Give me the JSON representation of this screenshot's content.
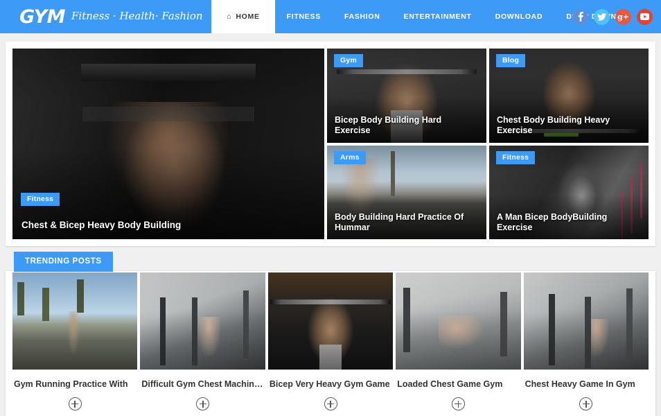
{
  "header": {
    "brand_logo": "GYM",
    "brand_tagline": "Fitness · Health· Fashion",
    "nav": [
      {
        "label": "HOME",
        "icon": "home-icon",
        "active": true
      },
      {
        "label": "FITNESS",
        "active": false
      },
      {
        "label": "FASHION",
        "active": false
      },
      {
        "label": "ENTERTAINMENT",
        "active": false
      },
      {
        "label": "DOWNLOAD",
        "active": false
      },
      {
        "label": "DROP DOWN",
        "active": false,
        "caret": true
      }
    ],
    "social": [
      {
        "name": "facebook-icon",
        "glyph": "f",
        "color": "#5b8fdb"
      },
      {
        "name": "twitter-icon",
        "glyph": "t",
        "color": "#4fc3f7"
      },
      {
        "name": "googleplus-icon",
        "glyph": "g+",
        "color": "#e8573f"
      },
      {
        "name": "youtube-icon",
        "glyph": "yt",
        "color": "#e8402f"
      }
    ],
    "accent_color": "#3d9bf7",
    "active_bg": "#ffffff"
  },
  "hero": {
    "main": {
      "badge": "Fitness",
      "title": "Chest & Bicep Heavy Body Building",
      "photo": "ph-lat"
    },
    "tiles": [
      {
        "badge": "Gym",
        "title": "Bicep Body Building Hard Exercise",
        "photo": "ph-barbell"
      },
      {
        "badge": "Blog",
        "title": "Chest Body Building Heavy Exercise",
        "photo": "ph-deadlift"
      },
      {
        "badge": "Arms",
        "title": "Body Building Hard Practice Of Hummar",
        "photo": "ph-outdoor"
      },
      {
        "badge": "Fitness",
        "title": "A Man Bicep BodyBuilding Exercise",
        "photo": "ph-gymsquat"
      }
    ]
  },
  "trending": {
    "heading": "TRENDING POSTS",
    "cards": [
      {
        "title": "Gym Running Practice With",
        "photo": "ph-run",
        "expand_icon": "plus-circle-icon"
      },
      {
        "title": "Difficult Gym Chest Machinery",
        "photo": "ph-machine",
        "expand_icon": "plus-circle-icon"
      },
      {
        "title": "Bicep Very Heavy Gym Game",
        "photo": "ph-press",
        "expand_icon": "plus-circle-icon"
      },
      {
        "title": "Loaded Chest Game Gym",
        "photo": "ph-pushup",
        "expand_icon": "plus-circle-icon"
      },
      {
        "title": "Chest Heavy Game In Gym",
        "photo": "ph-row",
        "expand_icon": "plus-circle-icon"
      }
    ]
  }
}
